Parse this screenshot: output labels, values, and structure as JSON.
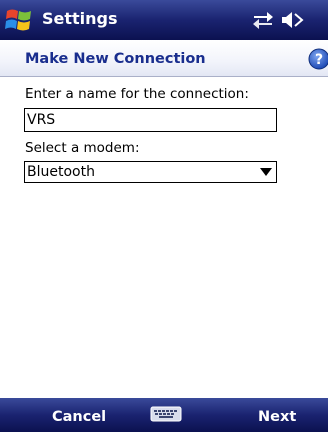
{
  "titlebar": {
    "title": "Settings",
    "icons": [
      "windows-start-icon",
      "sync-arrows-icon",
      "volume-muted-icon"
    ]
  },
  "header": {
    "title": "Make New Connection",
    "help_icon": "help-icon"
  },
  "form": {
    "name_label": "Enter a name for the connection:",
    "name_value": "VRS",
    "modem_label": "Select a modem:",
    "modem_value": "Bluetooth"
  },
  "softkeys": {
    "left": "Cancel",
    "right": "Next",
    "center_icon": "keyboard-icon"
  },
  "colors": {
    "bar_dark": "#0b1150",
    "bar_light": "#3a4a9a",
    "header_text": "#1a2e8e",
    "help_blue": "#2a5bc8"
  }
}
